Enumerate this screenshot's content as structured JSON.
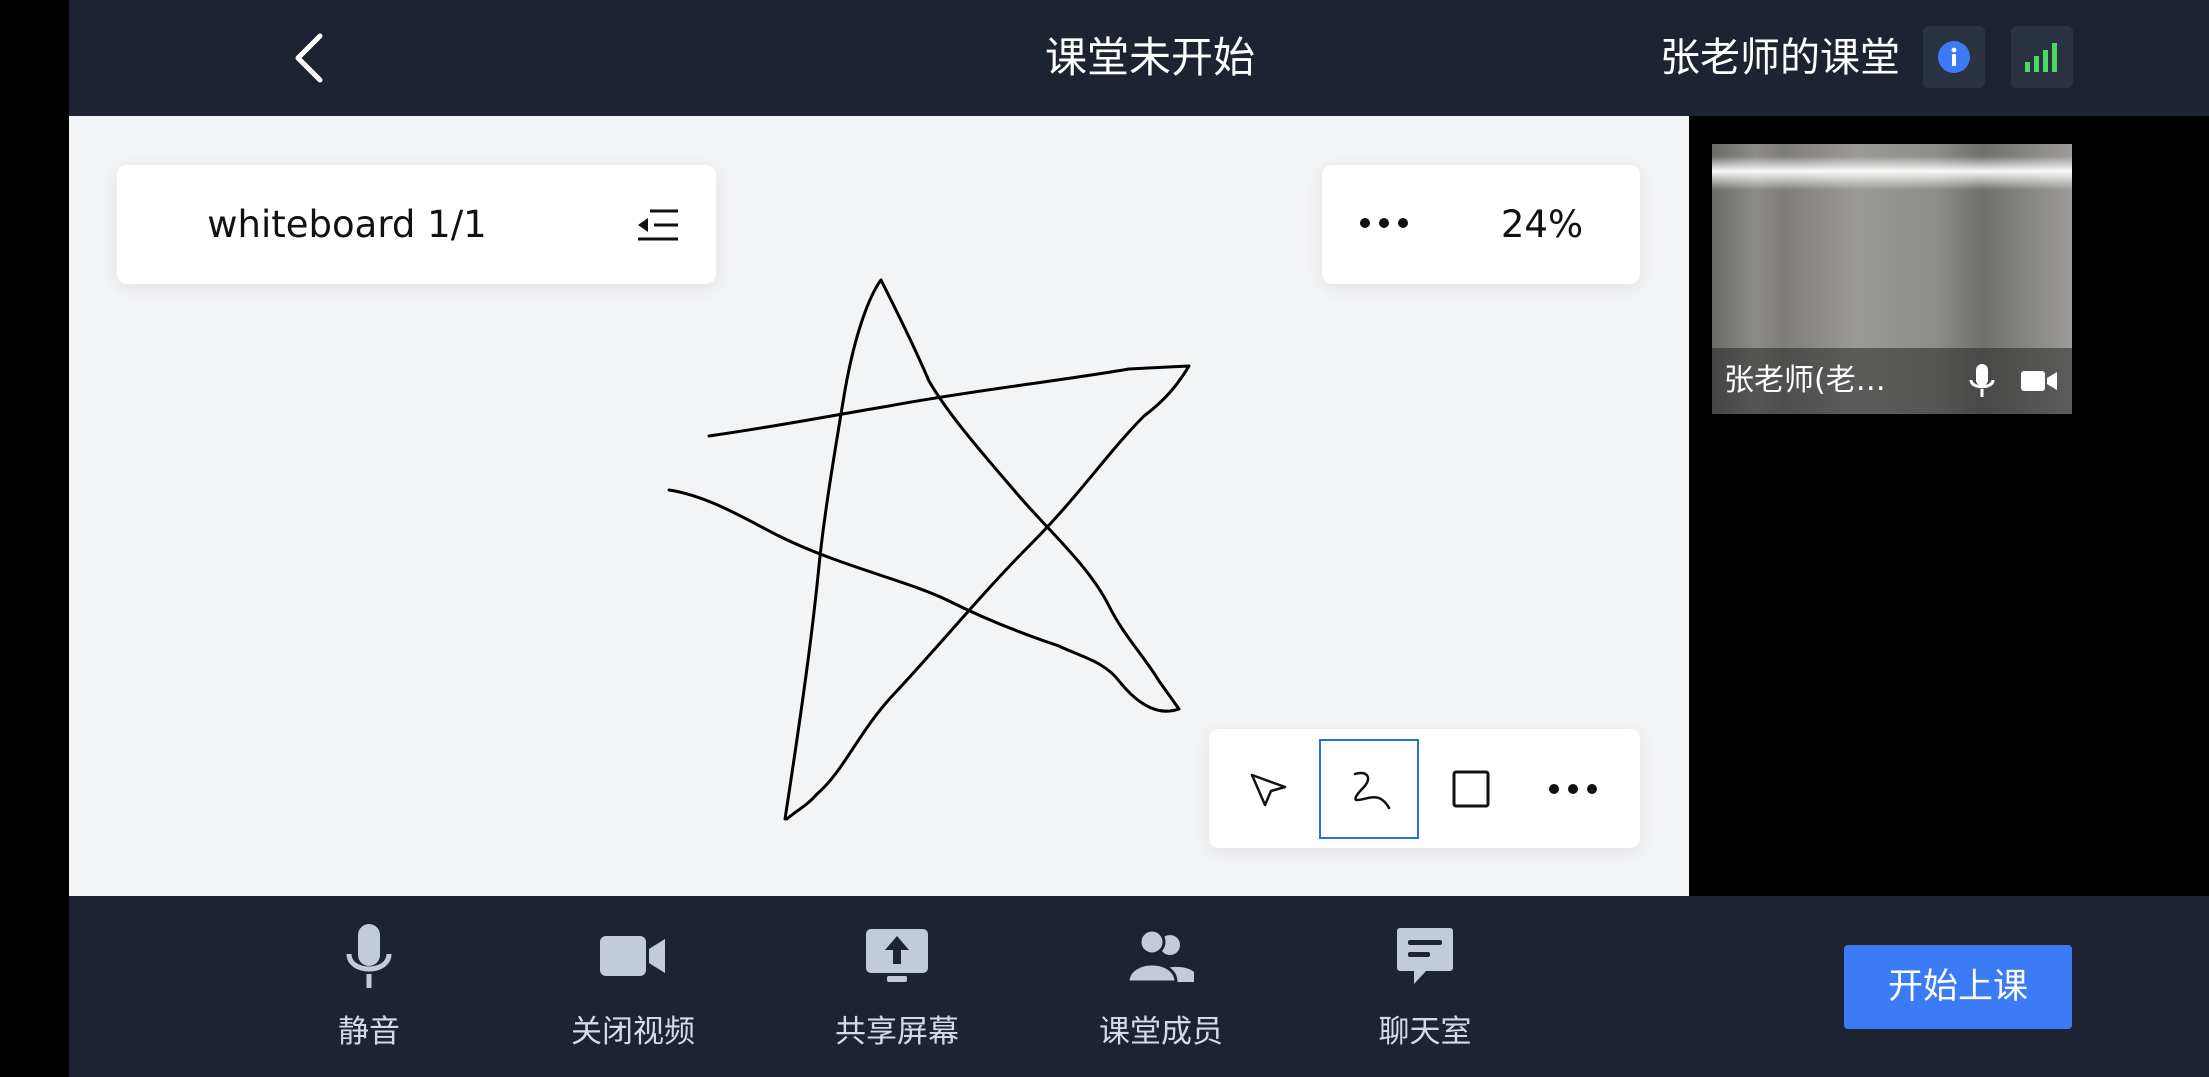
{
  "header": {
    "status_title": "课堂未开始",
    "class_name": "张老师的课堂"
  },
  "whiteboard": {
    "page_label": "whiteboard 1/1",
    "zoom": "24%"
  },
  "video": {
    "participant_name": "张老师(老…"
  },
  "controls": {
    "mute_label": "静音",
    "video_label": "关闭视频",
    "share_label": "共享屏幕",
    "members_label": "课堂成员",
    "chat_label": "聊天室",
    "start_label": "开始上课"
  },
  "colors": {
    "bar_bg": "#1d2332",
    "accent": "#3b7bf6",
    "signal": "#4cd964"
  }
}
